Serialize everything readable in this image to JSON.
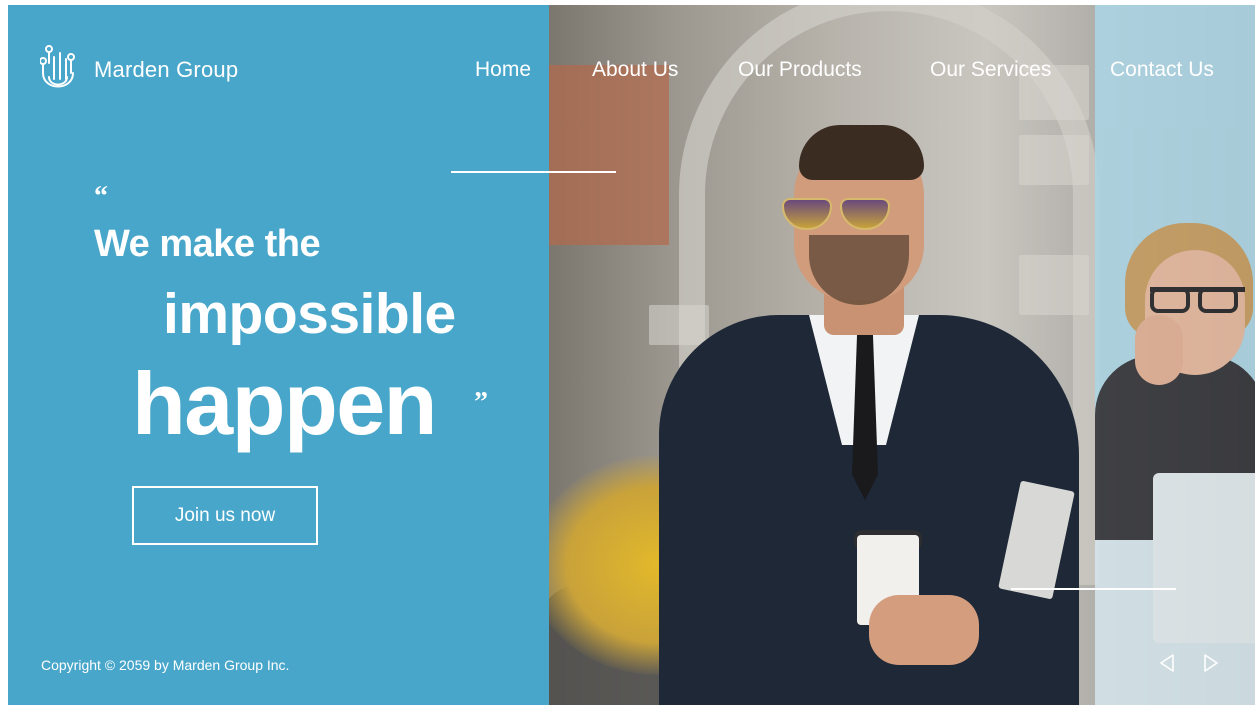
{
  "brand": {
    "name": "Marden Group",
    "icon": "circuit-hand-icon"
  },
  "nav": {
    "items": [
      {
        "label": "Home"
      },
      {
        "label": "About Us"
      },
      {
        "label": "Our Products"
      },
      {
        "label": "Our Services"
      },
      {
        "label": "Contact Us"
      }
    ]
  },
  "hero": {
    "quote_open": "“",
    "line1": "We make the",
    "line2": "impossible",
    "line3": "happen",
    "quote_close": "”",
    "cta_label": "Join us now"
  },
  "footer": {
    "copyright": "Copyright © 2059 by Marden Group Inc."
  },
  "carousel": {
    "prev_icon": "triangle-left-icon",
    "next_icon": "triangle-right-icon"
  },
  "colors": {
    "panel_blue": "#48a6ca",
    "text": "#ffffff",
    "tint_panel": "#acd6e6"
  }
}
